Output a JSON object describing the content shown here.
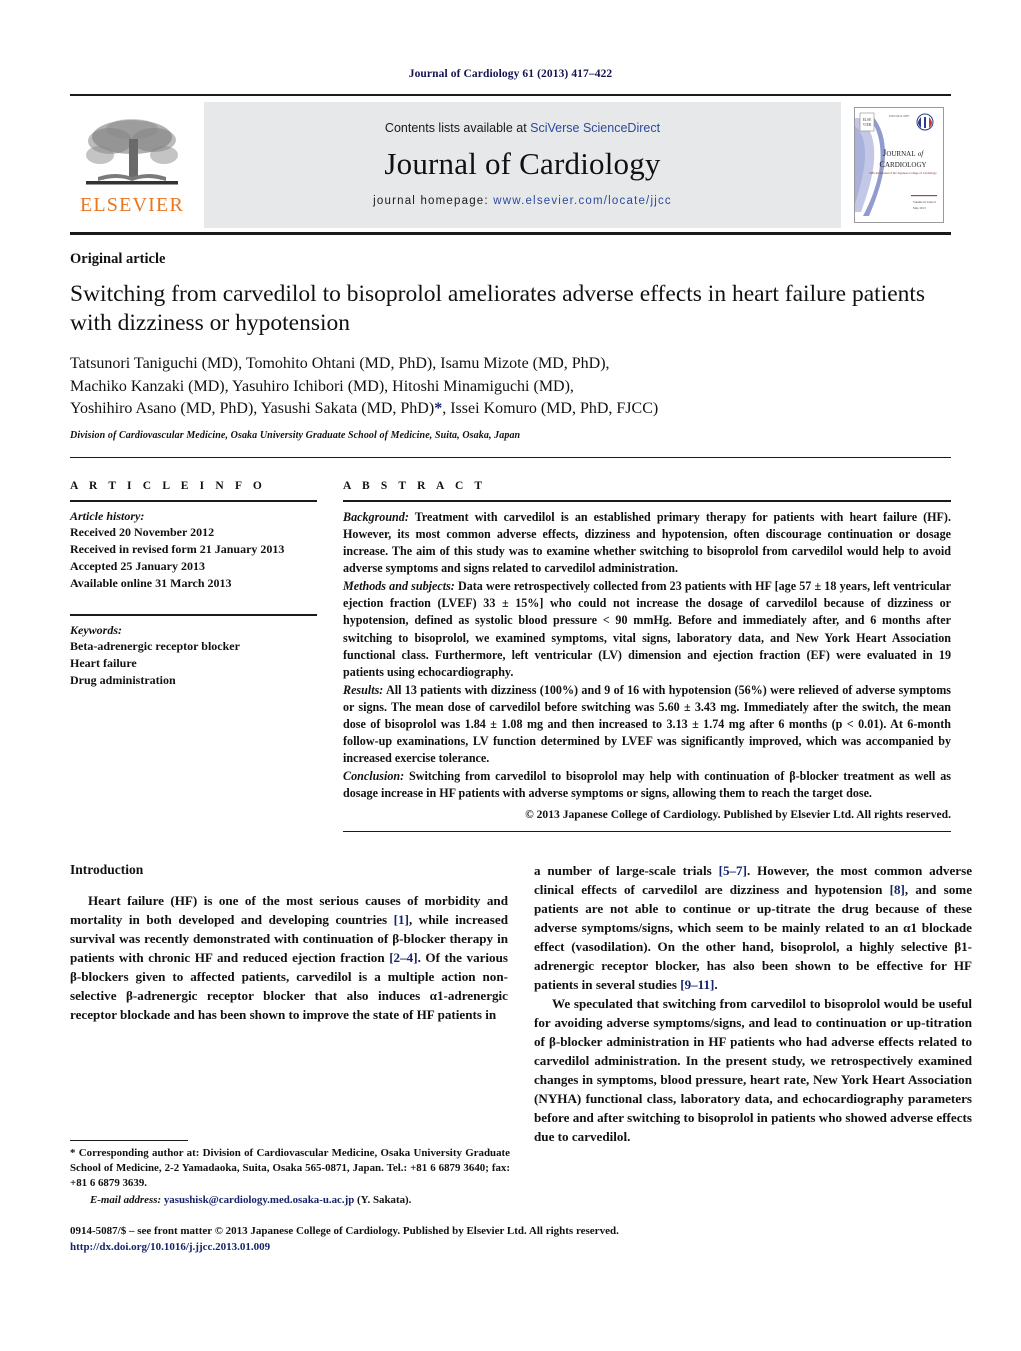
{
  "running_head": "Journal of Cardiology 61 (2013) 417–422",
  "masthead": {
    "publisher_name": "ELSEVIER",
    "publisher_logo_alt": "elsevier-tree-logo",
    "contents_prefix": "Contents lists available at ",
    "contents_link": "SciVerse ScienceDirect",
    "journal_name": "Journal of Cardiology",
    "homepage_prefix": "journal homepage: ",
    "homepage_url": "www.elsevier.com/locate/jjcc",
    "cover": {
      "title_line1": "JOURNAL of",
      "title_line2": "CARDIOLOGY",
      "subtitle": "Official Journal of the Japanese College of Cardiology",
      "volume_line1": "Volume 61 Issue 6",
      "volume_line2": "May 2013"
    }
  },
  "article": {
    "type": "Original article",
    "title": "Switching from carvedilol to bisoprolol ameliorates adverse effects in heart failure patients with dizziness or hypotension",
    "authors_line1": "Tatsunori Taniguchi (MD), Tomohito Ohtani (MD, PhD), Isamu Mizote (MD, PhD),",
    "authors_line2": "Machiko Kanzaki (MD), Yasuhiro Ichibori (MD), Hitoshi Minamiguchi (MD),",
    "authors_line3a": "Yoshihiro Asano (MD, PhD), Yasushi Sakata (MD, PhD)",
    "authors_star": "*",
    "authors_line3b": ", Issei Komuro (MD, PhD, FJCC)",
    "affiliation": "Division of Cardiovascular Medicine, Osaka University Graduate School of Medicine, Suita, Osaka, Japan"
  },
  "article_info": {
    "heading": "A R T I C L E  I N F O",
    "history_label": "Article history:",
    "history": [
      "Received 20 November 2012",
      "Received in revised form 21 January 2013",
      "Accepted 25 January 2013",
      "Available online 31 March 2013"
    ],
    "keywords_label": "Keywords:",
    "keywords": [
      "Beta-adrenergic receptor blocker",
      "Heart failure",
      "Drug administration"
    ]
  },
  "abstract": {
    "heading": "A B S T R A C T",
    "sections": [
      {
        "lead": "Background:",
        "text": " Treatment with carvedilol is an established primary therapy for patients with heart failure (HF). However, its most common adverse effects, dizziness and hypotension, often discourage continuation or dosage increase. The aim of this study was to examine whether switching to bisoprolol from carvedilol would help to avoid adverse symptoms and signs related to carvedilol administration."
      },
      {
        "lead": "Methods and subjects:",
        "text": " Data were retrospectively collected from 23 patients with HF [age 57 ± 18 years, left ventricular ejection fraction (LVEF) 33 ± 15%] who could not increase the dosage of carvedilol because of dizziness or hypotension, defined as systolic blood pressure < 90 mmHg. Before and immediately after, and 6 months after switching to bisoprolol, we examined symptoms, vital signs, laboratory data, and New York Heart Association functional class. Furthermore, left ventricular (LV) dimension and ejection fraction (EF) were evaluated in 19 patients using echocardiography."
      },
      {
        "lead": "Results:",
        "text": " All 13 patients with dizziness (100%) and 9 of 16 with hypotension (56%) were relieved of adverse symptoms or signs. The mean dose of carvedilol before switching was 5.60 ± 3.43 mg. Immediately after the switch, the mean dose of bisoprolol was 1.84 ± 1.08 mg and then increased to 3.13 ± 1.74 mg after 6 months (p < 0.01). At 6-month follow-up examinations, LV function determined by LVEF was significantly improved, which was accompanied by increased exercise tolerance."
      },
      {
        "lead": "Conclusion:",
        "text": " Switching from carvedilol to bisoprolol may help with continuation of β-blocker treatment as well as dosage increase in HF patients with adverse symptoms or signs, allowing them to reach the target dose."
      }
    ],
    "copyright": "© 2013 Japanese College of Cardiology. Published by Elsevier Ltd. All rights reserved."
  },
  "body": {
    "left_heading": "Introduction",
    "left_p1_a": "Heart failure (HF) is one of the most serious causes of morbidity and mortality in both developed and developing countries ",
    "left_p1_r1": "[1]",
    "left_p1_b": ", while increased survival was recently demonstrated with continuation of β-blocker therapy in patients with chronic HF and reduced ejection fraction ",
    "left_p1_r2": "[2–4]",
    "left_p1_c": ". Of the various β-blockers given to affected patients, carvedilol is a multiple action non-selective β-adrenergic receptor blocker that also induces α1-adrenergic receptor blockade and has been shown to improve the state of HF patients in",
    "right_p1_a": "a number of large-scale trials ",
    "right_p1_r1": "[5–7]",
    "right_p1_b": ". However, the most common adverse clinical effects of carvedilol are dizziness and hypotension ",
    "right_p1_r2": "[8]",
    "right_p1_c": ", and some patients are not able to continue or up-titrate the drug because of these adverse symptoms/signs, which seem to be mainly related to an α1 blockade effect (vasodilation). On the other hand, bisoprolol, a highly selective β1-adrenergic receptor blocker, has also been shown to be effective for HF patients in several studies ",
    "right_p1_r3": "[9–11]",
    "right_p1_d": ".",
    "right_p2": "We speculated that switching from carvedilol to bisoprolol would be useful for avoiding adverse symptoms/signs, and lead to continuation or up-titration of β-blocker administration in HF patients who had adverse effects related to carvedilol administration. In the present study, we retrospectively examined changes in symptoms, blood pressure, heart rate, New York Heart Association (NYHA) functional class, laboratory data, and echocardiography parameters before and after switching to bisoprolol in patients who showed adverse effects due to carvedilol."
  },
  "footnotes": {
    "corresponding": "* Corresponding author at: Division of Cardiovascular Medicine, Osaka University Graduate School of Medicine, 2-2 Yamadaoka, Suita, Osaka 565-0871, Japan. Tel.: +81 6 6879 3640; fax: +81 6 6879 3639.",
    "email_label": "E-mail address:",
    "email_address": "yasushisk@cardiology.med.osaka-u.ac.jp",
    "email_suffix": " (Y. Sakata)."
  },
  "imprint": {
    "issn_line": "0914-5087/$ – see front matter © 2013 Japanese College of Cardiology. Published by Elsevier Ltd. All rights reserved.",
    "doi": "http://dx.doi.org/10.1016/j.jjcc.2013.01.009"
  },
  "colors": {
    "navy": "#16246b",
    "link_blue": "#2a4b9b",
    "elsevier_orange": "#E87722",
    "banner_gray": "#e7e8ea"
  }
}
